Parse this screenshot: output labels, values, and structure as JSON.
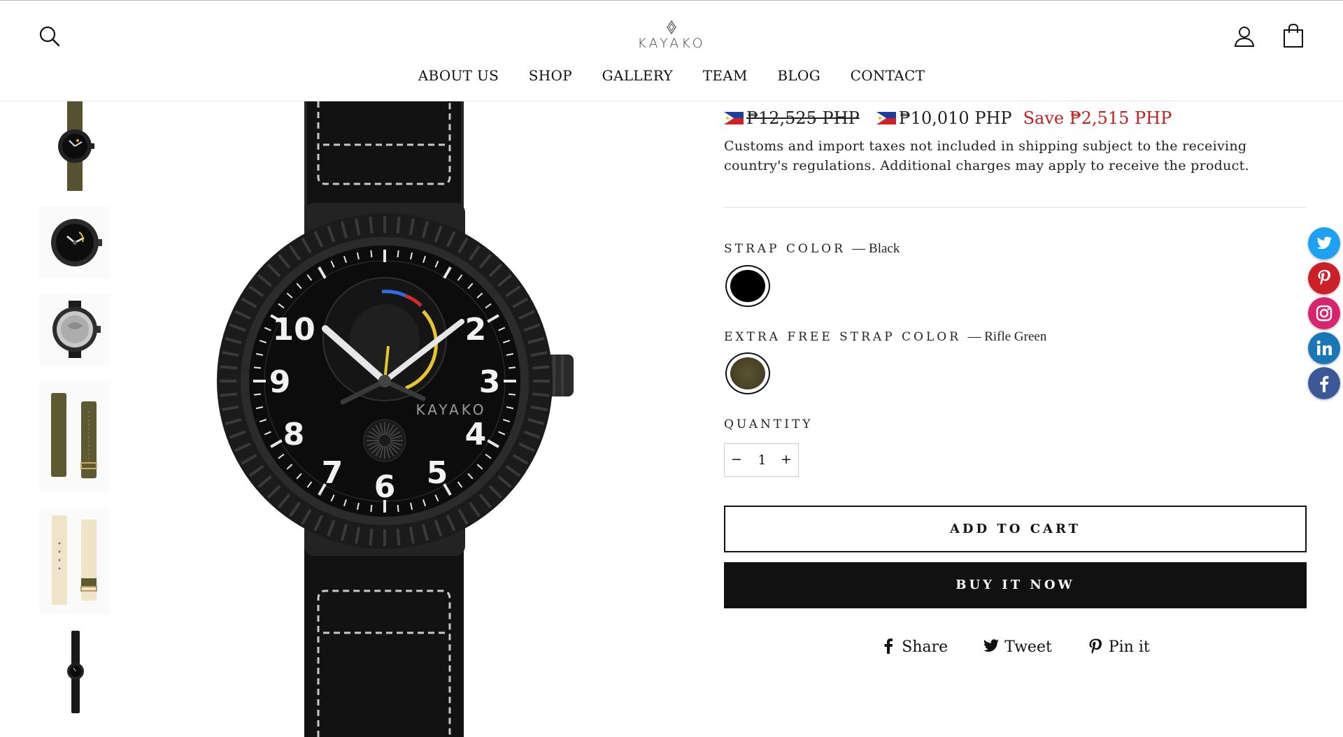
{
  "brand": {
    "name": "KAYAKO"
  },
  "nav": {
    "items": [
      "ABOUT US",
      "SHOP",
      "GALLERY",
      "TEAM",
      "BLOG",
      "CONTACT"
    ]
  },
  "watch_brand_text": "KAYAKO",
  "price": {
    "old": "₱12,525 PHP",
    "current": "₱10,010 PHP",
    "save": "Save ₱2,515 PHP"
  },
  "tax_note": "Customs and import taxes not included in shipping subject to the receiving country's regulations. Additional charges may apply to receive the product.",
  "options": {
    "strap_color": {
      "label": "STRAP COLOR",
      "value": "— Black",
      "swatch": "#000000"
    },
    "extra_strap_color": {
      "label": "EXTRA FREE STRAP COLOR",
      "value": "— Rifle Green",
      "swatch": "#4a4326"
    }
  },
  "quantity": {
    "label": "QUANTITY",
    "minus": "−",
    "value": "1",
    "plus": "+"
  },
  "buttons": {
    "add_to_cart": "ADD TO CART",
    "buy_now": "BUY IT NOW"
  },
  "share": {
    "share": "Share",
    "tweet": "Tweet",
    "pin": "Pin it"
  },
  "social_icons": [
    "twitter-icon",
    "pinterest-icon",
    "instagram-icon",
    "linkedin-icon",
    "facebook-icon"
  ],
  "colors": {
    "save_red": "#c41d1d",
    "buy_bg": "#111111"
  }
}
